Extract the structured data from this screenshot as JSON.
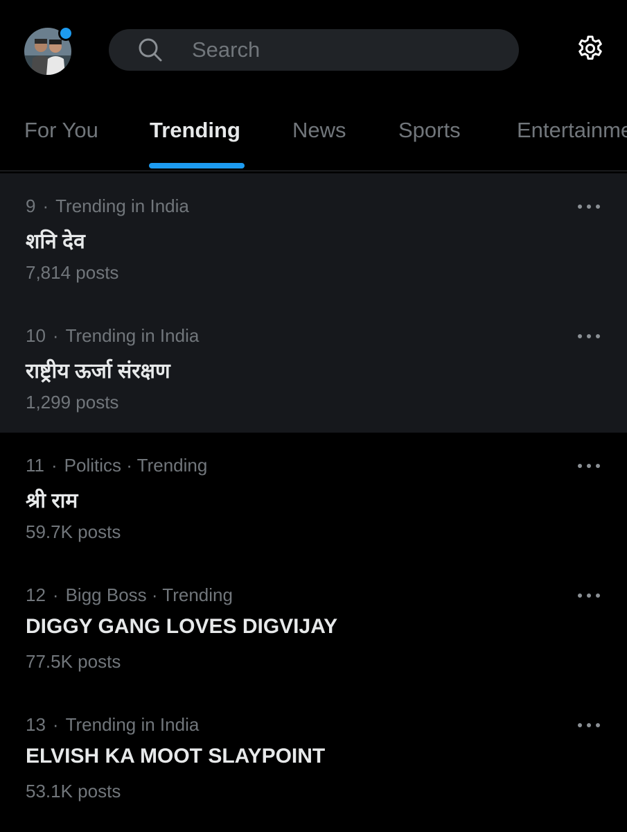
{
  "header": {
    "search_placeholder": "Search",
    "avatar_icon": "user-avatar",
    "search_icon": "search-icon",
    "settings_icon": "gear-icon",
    "notification_dot_color": "#1d9bf0"
  },
  "tabs": [
    {
      "label": "For You",
      "active": false
    },
    {
      "label": "Trending",
      "active": true
    },
    {
      "label": "News",
      "active": false
    },
    {
      "label": "Sports",
      "active": false
    },
    {
      "label": "Entertainment",
      "active": false
    }
  ],
  "trends": [
    {
      "rank": "9",
      "context": "Trending in India",
      "title": "शनि देव",
      "posts": "7,814 posts"
    },
    {
      "rank": "10",
      "context": "Trending in India",
      "title": "राष्ट्रीय ऊर्जा संरक्षण",
      "posts": "1,299 posts"
    },
    {
      "rank": "11",
      "context": "Politics · Trending",
      "title": "श्री राम",
      "posts": "59.7K posts"
    },
    {
      "rank": "12",
      "context": "Bigg Boss · Trending",
      "title": "DIGGY GANG LOVES DIGVIJAY",
      "posts": "77.5K posts"
    },
    {
      "rank": "13",
      "context": "Trending in India",
      "title": "ELVISH KA MOOT SLAYPOINT",
      "posts": "53.1K posts"
    }
  ],
  "colors": {
    "background": "#000000",
    "accent": "#1d9bf0",
    "secondary_text": "#71767b",
    "primary_text": "#e7e9ea"
  }
}
